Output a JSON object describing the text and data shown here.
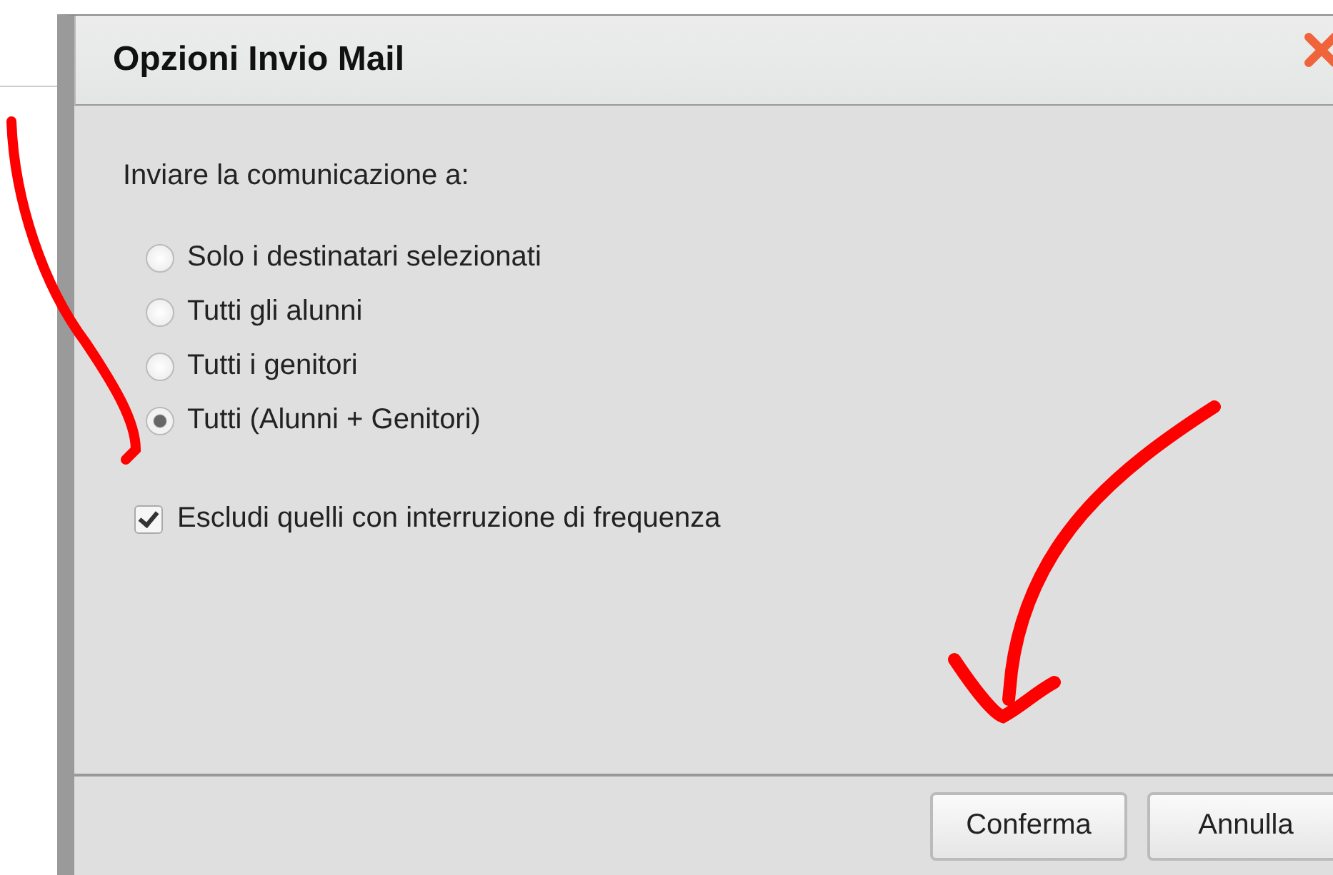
{
  "dialog": {
    "title": "Opzioni Invio Mail",
    "prompt": "Inviare la comunicazione a:",
    "options": [
      {
        "label": "Solo i destinatari selezionati",
        "selected": false
      },
      {
        "label": "Tutti gli alunni",
        "selected": false
      },
      {
        "label": "Tutti i genitori",
        "selected": false
      },
      {
        "label": "Tutti (Alunni + Genitori)",
        "selected": true
      }
    ],
    "exclude": {
      "label": "Escludi quelli con interruzione di frequenza",
      "checked": true
    },
    "buttons": [
      "Conferma",
      "Annulla"
    ]
  }
}
